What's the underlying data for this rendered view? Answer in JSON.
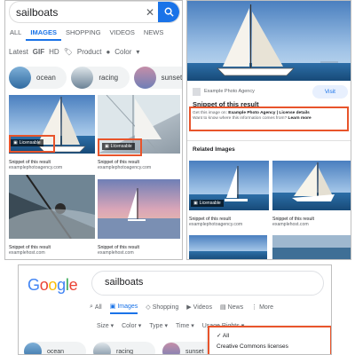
{
  "mobile_results": {
    "search": {
      "query": "sailboats"
    },
    "tabs": [
      {
        "label": "ALL"
      },
      {
        "label": "IMAGES",
        "active": true
      },
      {
        "label": "SHOPPING"
      },
      {
        "label": "VIDEOS"
      },
      {
        "label": "NEWS"
      }
    ],
    "filters": {
      "latest": "Latest",
      "gif": "GIF",
      "hd": "HD",
      "product": "Product",
      "color": "Color"
    },
    "chips": [
      {
        "label": "ocean"
      },
      {
        "label": "racing"
      },
      {
        "label": "sunset"
      }
    ],
    "results": [
      {
        "badge": "Licensable",
        "title": "Snippet of this result",
        "source": "examplephotoagency.com"
      },
      {
        "badge": "Licensable",
        "title": "Snippet of this result",
        "source": "examplephotoagency.com"
      },
      {
        "title": "Snippet of this result",
        "source": "examplehost.com"
      },
      {
        "title": "Snippet of this result",
        "source": "examplehost.com"
      }
    ]
  },
  "image_detail": {
    "agency": "Example Photo Agency",
    "visit_label": "Visit",
    "snippet_title": "Snippet of this result",
    "find_prefix": "Get this image on:",
    "find_link": "Example Photo Agency | License details",
    "want_prefix": "Want to know where this information comes from?",
    "want_link": "Learn more",
    "related_heading": "Related Images",
    "related": [
      {
        "badge": "Licensable",
        "title": "Snippet of this result",
        "source": "examplephotoagency.com"
      },
      {
        "title": "Snippet of this result",
        "source": "examplehost.com"
      }
    ]
  },
  "desktop_results": {
    "logo": "Google",
    "query": "sailboats",
    "tabs": [
      {
        "label": "All",
        "icon": "search-icon"
      },
      {
        "label": "Images",
        "icon": "image-icon",
        "active": true
      },
      {
        "label": "Shopping",
        "icon": "tag-icon"
      },
      {
        "label": "Videos",
        "icon": "video-icon"
      },
      {
        "label": "News",
        "icon": "news-icon"
      },
      {
        "label": "More",
        "icon": "more-icon"
      }
    ],
    "tools": [
      {
        "label": "Size"
      },
      {
        "label": "Color"
      },
      {
        "label": "Type"
      },
      {
        "label": "Time"
      },
      {
        "label": "Usage Rights"
      }
    ],
    "usage_rights_options": [
      {
        "label": "All",
        "checked": true
      },
      {
        "label": "Creative Commons licenses"
      }
    ],
    "chips": [
      {
        "label": "ocean"
      },
      {
        "label": "racing"
      },
      {
        "label": "sunset"
      }
    ]
  },
  "colors": {
    "accent": "#1a73e8",
    "highlight": "#e8542b",
    "chip_bg": "#f1f3f4"
  }
}
